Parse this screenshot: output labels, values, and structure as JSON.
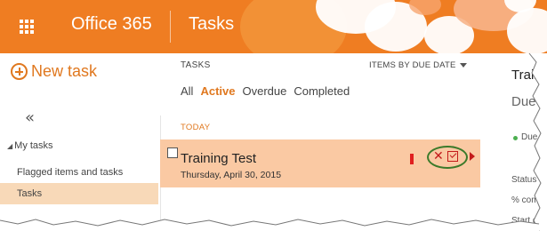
{
  "header": {
    "brand": "Office 365",
    "app_title": "Tasks",
    "bar_color": "#ef7d22"
  },
  "nav": {
    "new_task_label": "New task",
    "collapse_glyph": "«",
    "group_label": "My tasks",
    "items": [
      {
        "label": "Flagged items and tasks",
        "selected": false
      },
      {
        "label": "Tasks",
        "selected": true
      }
    ]
  },
  "list": {
    "heading": "TASKS",
    "sort_label": "ITEMS BY DUE DATE",
    "filters": [
      "All",
      "Active",
      "Overdue",
      "Completed"
    ],
    "active_filter": "Active",
    "group_label": "TODAY",
    "task": {
      "title": "Training Test",
      "date": "Thursday, April 30, 2015",
      "flag_color": "#e01f1f",
      "delete_glyph": "✕"
    }
  },
  "details": {
    "title_partial": "Traini",
    "due_partial": "Due",
    "due_line_partial": "Due",
    "status_partial": "Status",
    "percent_partial": "% com",
    "start_partial": "Start d"
  },
  "colors": {
    "accent": "#e0781f",
    "selected_row": "#fac9a3",
    "selected_nav": "#f8d9b8",
    "highlight_ellipse": "#3b7a2a"
  },
  "icons": {
    "app_launcher": "waffle-icon",
    "new_task": "plus-circle-icon",
    "delete": "close-icon",
    "mark_complete": "checkbox-check-icon",
    "sort_caret": "chevron-down-icon"
  }
}
